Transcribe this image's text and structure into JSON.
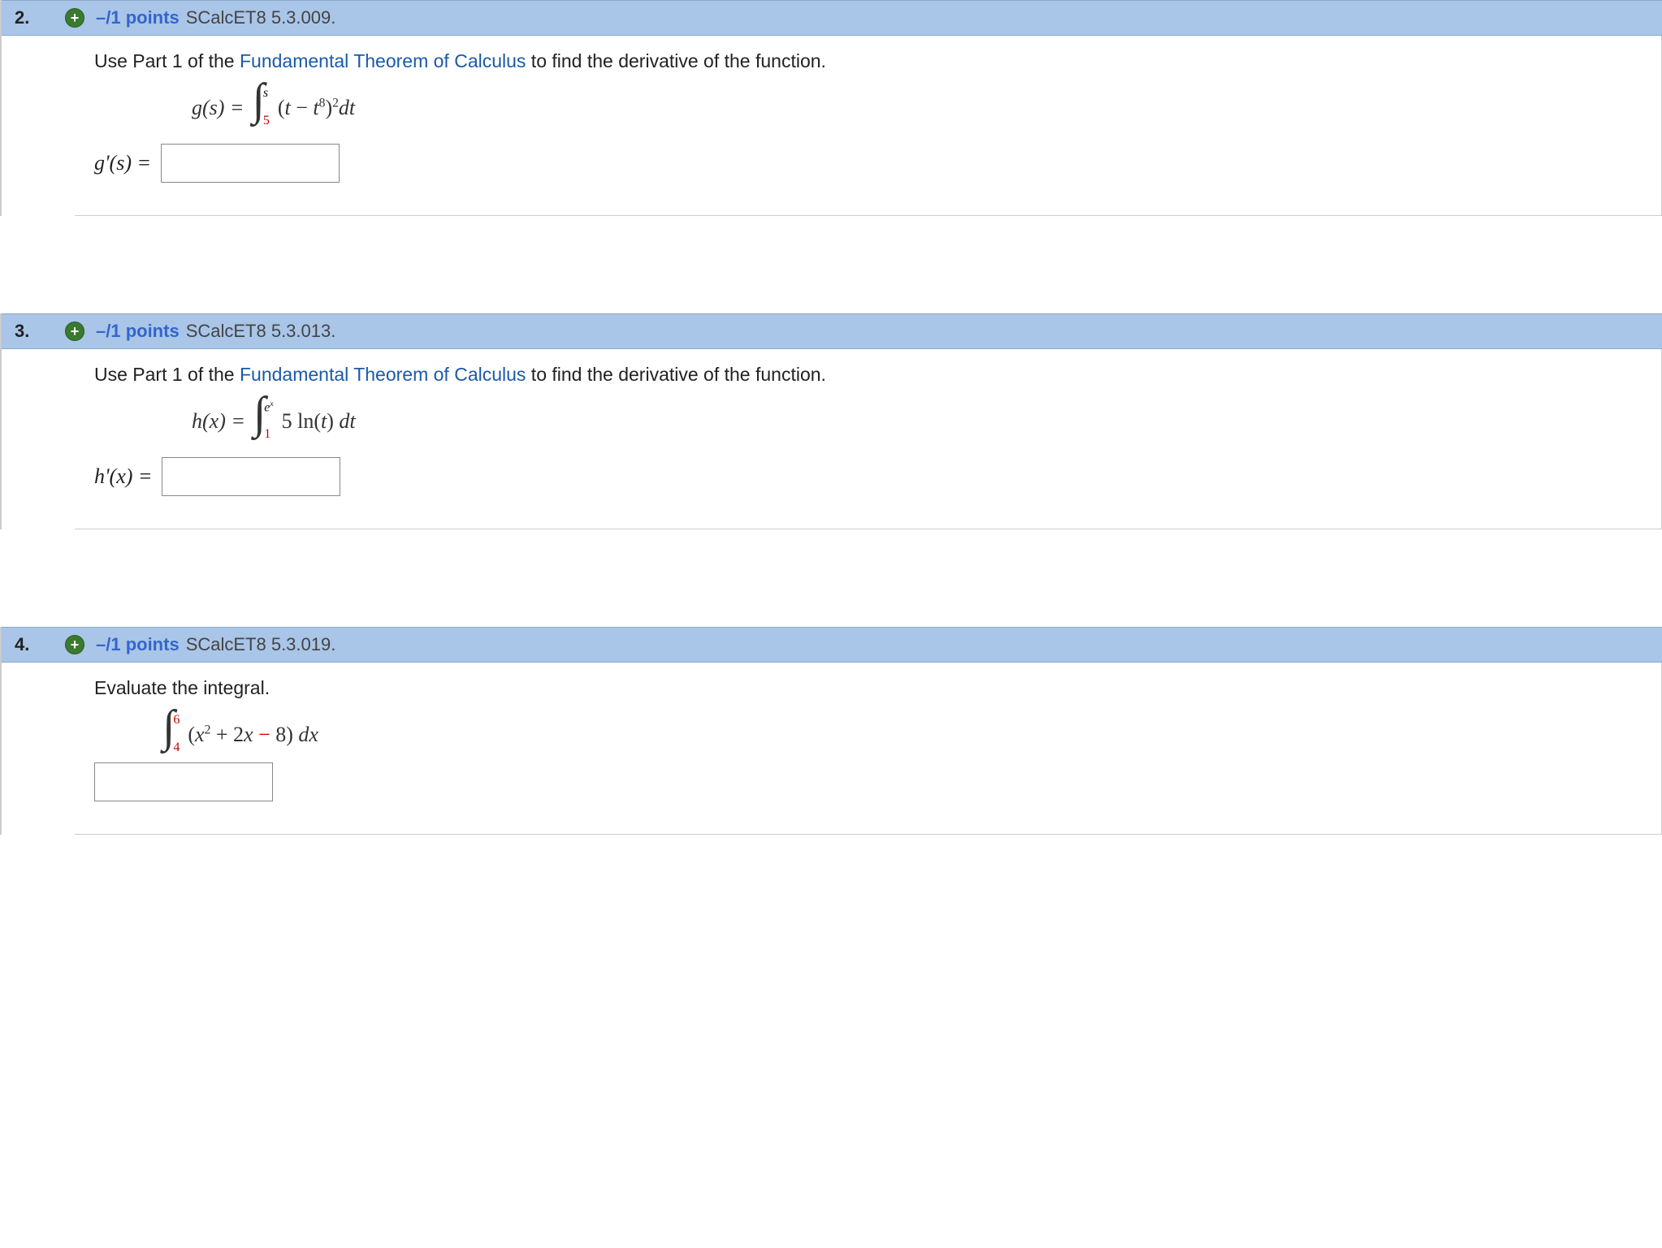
{
  "questions": [
    {
      "number": "2.",
      "points": "–/1 points",
      "source": "SCalcET8 5.3.009.",
      "prompt_pre": "Use Part 1 of the ",
      "prompt_link": "Fundamental Theorem of Calculus",
      "prompt_post": " to find the derivative of the function.",
      "func_lhs": "g(s) = ",
      "int_upper": "s",
      "int_lower": "5",
      "integrand_a": "(t",
      "integrand_minus": " − ",
      "integrand_b": "t",
      "integrand_b_sup": "8",
      "integrand_c": ")",
      "integrand_c_sup": "2",
      "integrand_d": "dt",
      "answer_label": "g'(s)  ="
    },
    {
      "number": "3.",
      "points": "–/1 points",
      "source": "SCalcET8 5.3.013.",
      "prompt_pre": "Use Part 1 of the ",
      "prompt_link": "Fundamental Theorem of Calculus",
      "prompt_post": " to find the derivative of the function.",
      "func_lhs": "h(x) = ",
      "int_upper_a": "e",
      "int_upper_b": "x",
      "int_lower": "1",
      "integrand_a": "5 ln(",
      "integrand_b": "t",
      "integrand_c": ") ",
      "integrand_d": "dt",
      "answer_label": "h'(x)  ="
    },
    {
      "number": "4.",
      "points": "–/1 points",
      "source": "SCalcET8 5.3.019.",
      "prompt": "Evaluate the integral.",
      "int_upper": "6",
      "int_lower": "4",
      "integrand_a": "(x",
      "integrand_a_sup": "2",
      "integrand_b": " + 2x",
      "integrand_minus": " − ",
      "integrand_c": "8) ",
      "integrand_d": "dx"
    }
  ]
}
